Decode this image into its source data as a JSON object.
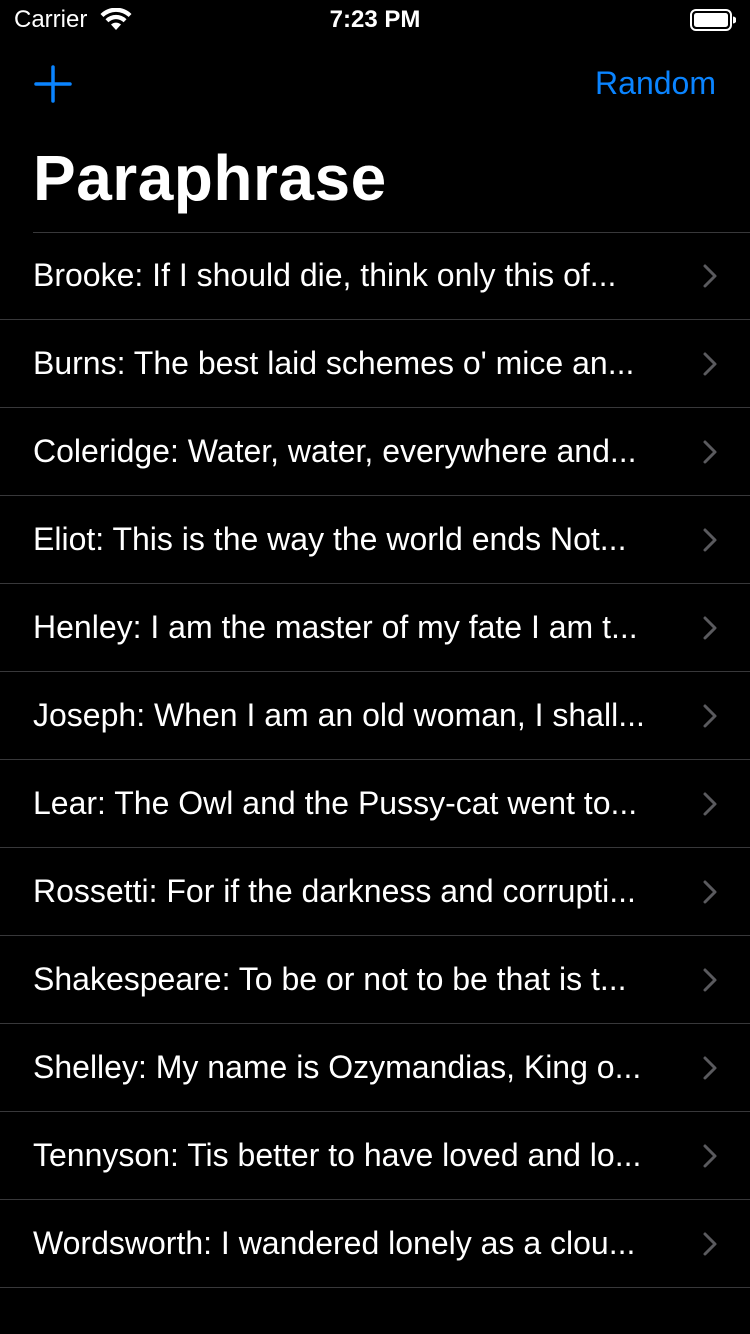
{
  "status_bar": {
    "carrier": "Carrier",
    "time": "7:23 PM"
  },
  "nav": {
    "add_icon": "plus-icon",
    "random_label": "Random",
    "title": "Paraphrase"
  },
  "colors": {
    "accent": "#0a84ff",
    "background": "#000000",
    "separator": "#38383a",
    "chevron": "#5a5a5e"
  },
  "items": [
    {
      "label": "Brooke: If I should die, think only this of..."
    },
    {
      "label": "Burns: The best laid schemes o' mice an..."
    },
    {
      "label": "Coleridge: Water, water, everywhere and..."
    },
    {
      "label": "Eliot: This is the way the world ends Not..."
    },
    {
      "label": "Henley: I am the master of my fate I am t..."
    },
    {
      "label": "Joseph: When I am an old woman, I shall..."
    },
    {
      "label": "Lear: The Owl and the Pussy-cat went to..."
    },
    {
      "label": "Rossetti: For if the darkness and corrupti..."
    },
    {
      "label": "Shakespeare: To be or not to be that is t..."
    },
    {
      "label": "Shelley: My name is Ozymandias, King o..."
    },
    {
      "label": "Tennyson: Tis better to have loved and lo..."
    },
    {
      "label": "Wordsworth: I wandered lonely as a clou..."
    }
  ]
}
